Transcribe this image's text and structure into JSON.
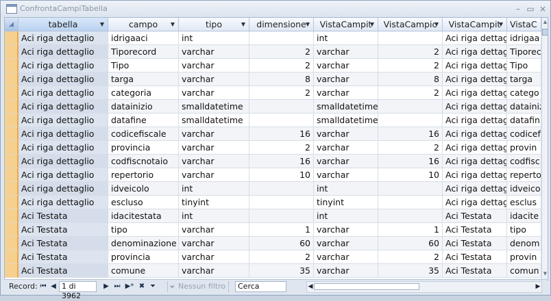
{
  "window": {
    "title": "ConfrontaCampiTabella",
    "buttons": {
      "minimize": "–",
      "restore": "▭",
      "close": "×"
    }
  },
  "grid": {
    "columns": [
      "tabella",
      "campo",
      "tipo",
      "dimensione",
      "VistaCampit",
      "VistaCampic",
      "VistaCampit",
      "VistaC"
    ],
    "column_filters": [
      true,
      true,
      true,
      true,
      true,
      true,
      true,
      false
    ],
    "rows": [
      [
        "Aci riga dettaglio",
        "idrigaaci",
        "int",
        "",
        "int",
        "",
        "Aci riga dettag",
        "idrigaa"
      ],
      [
        "Aci riga dettaglio",
        "Tiporecord",
        "varchar",
        "2",
        "varchar",
        "2",
        "Aci riga dettag",
        "Tiporec"
      ],
      [
        "Aci riga dettaglio",
        "Tipo",
        "varchar",
        "2",
        "varchar",
        "2",
        "Aci riga dettag",
        "Tipo"
      ],
      [
        "Aci riga dettaglio",
        "targa",
        "varchar",
        "8",
        "varchar",
        "8",
        "Aci riga dettag",
        "targa"
      ],
      [
        "Aci riga dettaglio",
        "categoria",
        "varchar",
        "2",
        "varchar",
        "2",
        "Aci riga dettag",
        "catego"
      ],
      [
        "Aci riga dettaglio",
        "datainizio",
        "smalldatetime",
        "",
        "smalldatetime",
        "",
        "Aci riga dettag",
        "datainiz"
      ],
      [
        "Aci riga dettaglio",
        "datafine",
        "smalldatetime",
        "",
        "smalldatetime",
        "",
        "Aci riga dettag",
        "datafin"
      ],
      [
        "Aci riga dettaglio",
        "codicefiscale",
        "varchar",
        "16",
        "varchar",
        "16",
        "Aci riga dettag",
        "codicef"
      ],
      [
        "Aci riga dettaglio",
        "provincia",
        "varchar",
        "2",
        "varchar",
        "2",
        "Aci riga dettag",
        "provin"
      ],
      [
        "Aci riga dettaglio",
        "codfiscnotaio",
        "varchar",
        "16",
        "varchar",
        "16",
        "Aci riga dettag",
        "codfisc"
      ],
      [
        "Aci riga dettaglio",
        "repertorio",
        "varchar",
        "10",
        "varchar",
        "10",
        "Aci riga dettag",
        "reperto"
      ],
      [
        "Aci riga dettaglio",
        "idveicolo",
        "int",
        "",
        "int",
        "",
        "Aci riga dettag",
        "idveico"
      ],
      [
        "Aci riga dettaglio",
        "escluso",
        "tinyint",
        "",
        "tinyint",
        "",
        "Aci riga dettag",
        "esclus"
      ],
      [
        "Aci Testata",
        "idacitestata",
        "int",
        "",
        "int",
        "",
        "Aci Testata",
        "idacite"
      ],
      [
        "Aci Testata",
        "tipo",
        "varchar",
        "1",
        "varchar",
        "1",
        "Aci Testata",
        "tipo"
      ],
      [
        "Aci Testata",
        "denominazione",
        "varchar",
        "60",
        "varchar",
        "60",
        "Aci Testata",
        "denom"
      ],
      [
        "Aci Testata",
        "provincia",
        "varchar",
        "2",
        "varchar",
        "2",
        "Aci Testata",
        "provin"
      ],
      [
        "Aci Testata",
        "comune",
        "varchar",
        "35",
        "varchar",
        "35",
        "Aci Testata",
        "comun"
      ]
    ]
  },
  "navigation": {
    "record_label": "Record:",
    "record_value": "1 di 3962",
    "filter_label": "Nessun filtro",
    "search_placeholder": "Cerca"
  }
}
